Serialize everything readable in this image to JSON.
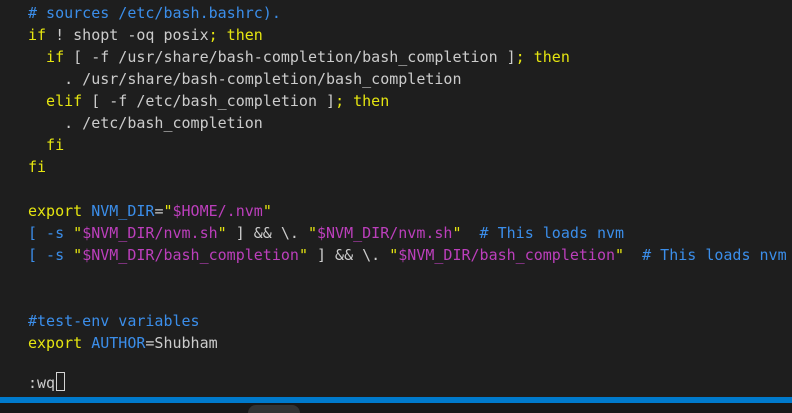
{
  "editor": {
    "lines": [
      {
        "segments": [
          {
            "text": "# sources /etc/bash.bashrc).",
            "color": "#3b8eea"
          }
        ]
      },
      {
        "segments": [
          {
            "text": "if",
            "color": "#e5e510"
          },
          {
            "text": " ! shopt -oq posix",
            "color": "#cccccc"
          },
          {
            "text": "; then",
            "color": "#e5e510"
          }
        ]
      },
      {
        "segments": [
          {
            "text": "  if",
            "color": "#e5e510"
          },
          {
            "text": " [ -f /usr/share/bash-completion/bash_completion ]",
            "color": "#cccccc"
          },
          {
            "text": "; then",
            "color": "#e5e510"
          }
        ]
      },
      {
        "segments": [
          {
            "text": "    . /usr/share/bash-completion/bash_completion",
            "color": "#cccccc"
          }
        ]
      },
      {
        "segments": [
          {
            "text": "  elif",
            "color": "#e5e510"
          },
          {
            "text": " [ -f /etc/bash_completion ]",
            "color": "#cccccc"
          },
          {
            "text": "; then",
            "color": "#e5e510"
          }
        ]
      },
      {
        "segments": [
          {
            "text": "    . /etc/bash_completion",
            "color": "#cccccc"
          }
        ]
      },
      {
        "segments": [
          {
            "text": "  fi",
            "color": "#e5e510"
          }
        ]
      },
      {
        "segments": [
          {
            "text": "fi",
            "color": "#e5e510"
          }
        ]
      },
      {
        "segments": []
      },
      {
        "segments": [
          {
            "text": "export ",
            "color": "#e5e510"
          },
          {
            "text": "NVM_DIR",
            "color": "#3b8eea"
          },
          {
            "text": "=",
            "color": "#cccccc"
          },
          {
            "text": "\"",
            "color": "#e5e510"
          },
          {
            "text": "$HOME",
            "color": "#bc3fbc"
          },
          {
            "text": "/.nvm",
            "color": "#bc3fbc"
          },
          {
            "text": "\"",
            "color": "#e5e510"
          }
        ]
      },
      {
        "segments": [
          {
            "text": "[ -s ",
            "color": "#3b8eea"
          },
          {
            "text": "\"",
            "color": "#e5e510"
          },
          {
            "text": "$NVM_DIR",
            "color": "#bc3fbc"
          },
          {
            "text": "/nvm.sh",
            "color": "#bc3fbc"
          },
          {
            "text": "\"",
            "color": "#e5e510"
          },
          {
            "text": " ] && \\. ",
            "color": "#cccccc"
          },
          {
            "text": "\"",
            "color": "#e5e510"
          },
          {
            "text": "$NVM_DIR",
            "color": "#bc3fbc"
          },
          {
            "text": "/nvm.sh",
            "color": "#bc3fbc"
          },
          {
            "text": "\"",
            "color": "#e5e510"
          },
          {
            "text": "  # This loads nvm",
            "color": "#3b8eea"
          }
        ]
      },
      {
        "segments": [
          {
            "text": "[ -s ",
            "color": "#3b8eea"
          },
          {
            "text": "\"",
            "color": "#e5e510"
          },
          {
            "text": "$NVM_DIR",
            "color": "#bc3fbc"
          },
          {
            "text": "/bash_completion",
            "color": "#bc3fbc"
          },
          {
            "text": "\"",
            "color": "#e5e510"
          },
          {
            "text": " ] && \\. ",
            "color": "#cccccc"
          },
          {
            "text": "\"",
            "color": "#e5e510"
          },
          {
            "text": "$NVM_DIR",
            "color": "#bc3fbc"
          },
          {
            "text": "/bash_completion",
            "color": "#bc3fbc"
          },
          {
            "text": "\"",
            "color": "#e5e510"
          },
          {
            "text": "  # This loads nvm",
            "color": "#3b8eea"
          }
        ]
      },
      {
        "segments": []
      },
      {
        "segments": []
      },
      {
        "segments": [
          {
            "text": "#test-env variables",
            "color": "#3b8eea"
          }
        ]
      },
      {
        "segments": [
          {
            "text": "export ",
            "color": "#e5e510"
          },
          {
            "text": "AUTHOR",
            "color": "#3b8eea"
          },
          {
            "text": "=Shubham",
            "color": "#cccccc"
          }
        ]
      },
      {
        "segments": []
      }
    ],
    "command_line": ":wq"
  },
  "colors": {
    "background": "#1e1e1e",
    "status_bar": "#007acc"
  }
}
